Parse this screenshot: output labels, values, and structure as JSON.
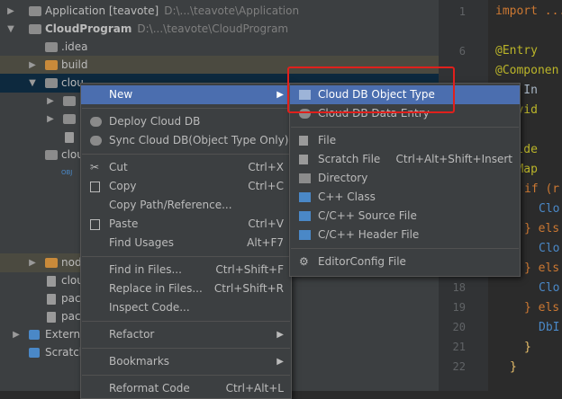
{
  "tree": {
    "application": {
      "label": "Application [teavote]",
      "path": "D:\\...\\teavote\\Application"
    },
    "cloudprogram": {
      "label": "CloudProgram",
      "path": "D:\\...\\teavote\\CloudProgram"
    },
    "idea": ".idea",
    "build": "build",
    "cloud_sel": "clou",
    "cloud2": "clou",
    "obj_badge": "OBJ",
    "node": "nod",
    "cloud3": "clou",
    "pac1": "pac",
    "pac2": "pac",
    "external": "Externa",
    "scratch": "Scratch"
  },
  "editor": {
    "line_numbers": [
      "1",
      "6",
      "18",
      "19",
      "20",
      "21",
      "22"
    ],
    "code": [
      "import ...",
      "@Entry",
      "@Componen",
      "uct In",
      "Provid",
      "Builde",
      "athMap",
      "if (r",
      "Clo",
      "} els",
      "Clo",
      "} els",
      "Clo",
      "} els",
      "DbI",
      "}",
      "}"
    ]
  },
  "menu": {
    "new": "New",
    "deploy": "Deploy Cloud DB",
    "sync": "Sync Cloud DB(Object Type Only)",
    "cut": "Cut",
    "cut_sc": "Ctrl+X",
    "copy": "Copy",
    "copy_sc": "Ctrl+C",
    "copy_path": "Copy Path/Reference...",
    "paste": "Paste",
    "paste_sc": "Ctrl+V",
    "find_usages": "Find Usages",
    "find_usages_sc": "Alt+F7",
    "find_in_files": "Find in Files...",
    "find_in_files_sc": "Ctrl+Shift+F",
    "replace_in_files": "Replace in Files...",
    "replace_in_files_sc": "Ctrl+Shift+R",
    "inspect": "Inspect Code...",
    "refactor": "Refactor",
    "bookmarks": "Bookmarks",
    "reformat": "Reformat Code",
    "reformat_sc": "Ctrl+Alt+L"
  },
  "submenu": {
    "cloud_db_object_type": "Cloud DB Object Type",
    "cloud_db_data_entry": "Cloud DB Data Entry",
    "file": "File",
    "scratch_file": "Scratch File",
    "scratch_file_sc": "Ctrl+Alt+Shift+Insert",
    "directory": "Directory",
    "cpp_class": "C++ Class",
    "cpp_source": "C/C++ Source File",
    "cpp_header": "C/C++ Header File",
    "editorconfig": "EditorConfig File"
  },
  "colors": {
    "highlight": "#e0201c",
    "selection": "#4b6eaf"
  }
}
